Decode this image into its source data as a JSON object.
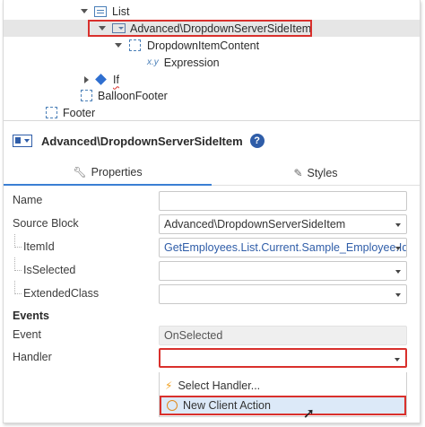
{
  "tree": {
    "items": [
      {
        "label": "List",
        "icon": "list-icon"
      },
      {
        "label": "Advanced\\DropdownServerSideItem",
        "icon": "dropdown-widget-icon",
        "selected": true
      },
      {
        "label": "DropdownItemContent",
        "icon": "placeholder-icon"
      },
      {
        "label": "Expression",
        "icon": "expression-icon",
        "icon_text": "x.y"
      },
      {
        "label": "If",
        "icon": "if-icon"
      },
      {
        "label": "BalloonFooter",
        "icon": "placeholder-icon"
      },
      {
        "label": "Footer",
        "icon": "placeholder-icon"
      }
    ]
  },
  "properties_panel": {
    "title": "Advanced\\DropdownServerSideItem",
    "help_label": "?",
    "tabs": [
      {
        "label": "Properties",
        "icon": "wrench-icon",
        "active": true
      },
      {
        "label": "Styles",
        "icon": "brush-icon",
        "active": false
      }
    ],
    "fields": {
      "name": {
        "label": "Name",
        "value": ""
      },
      "source_block": {
        "label": "Source Block",
        "value": "Advanced\\DropdownServerSideItem"
      },
      "item_id": {
        "label": "ItemId",
        "value": "GetEmployees.List.Current.Sample_Employee.Id"
      },
      "is_selected": {
        "label": "IsSelected",
        "value": ""
      },
      "extended_class": {
        "label": "ExtendedClass",
        "value": ""
      }
    },
    "events_section": "Events",
    "event": {
      "label": "Event",
      "value": "OnSelected"
    },
    "handler": {
      "label": "Handler",
      "value": ""
    },
    "handler_options": [
      {
        "label": "Select Handler...",
        "icon": "lightning-icon"
      },
      {
        "label": "New Client Action",
        "icon": "circle-icon",
        "highlighted": true
      }
    ]
  },
  "colors": {
    "accent": "#2f5da8",
    "highlight_border": "#d9302c",
    "selected_row": "#e6e6e6"
  }
}
